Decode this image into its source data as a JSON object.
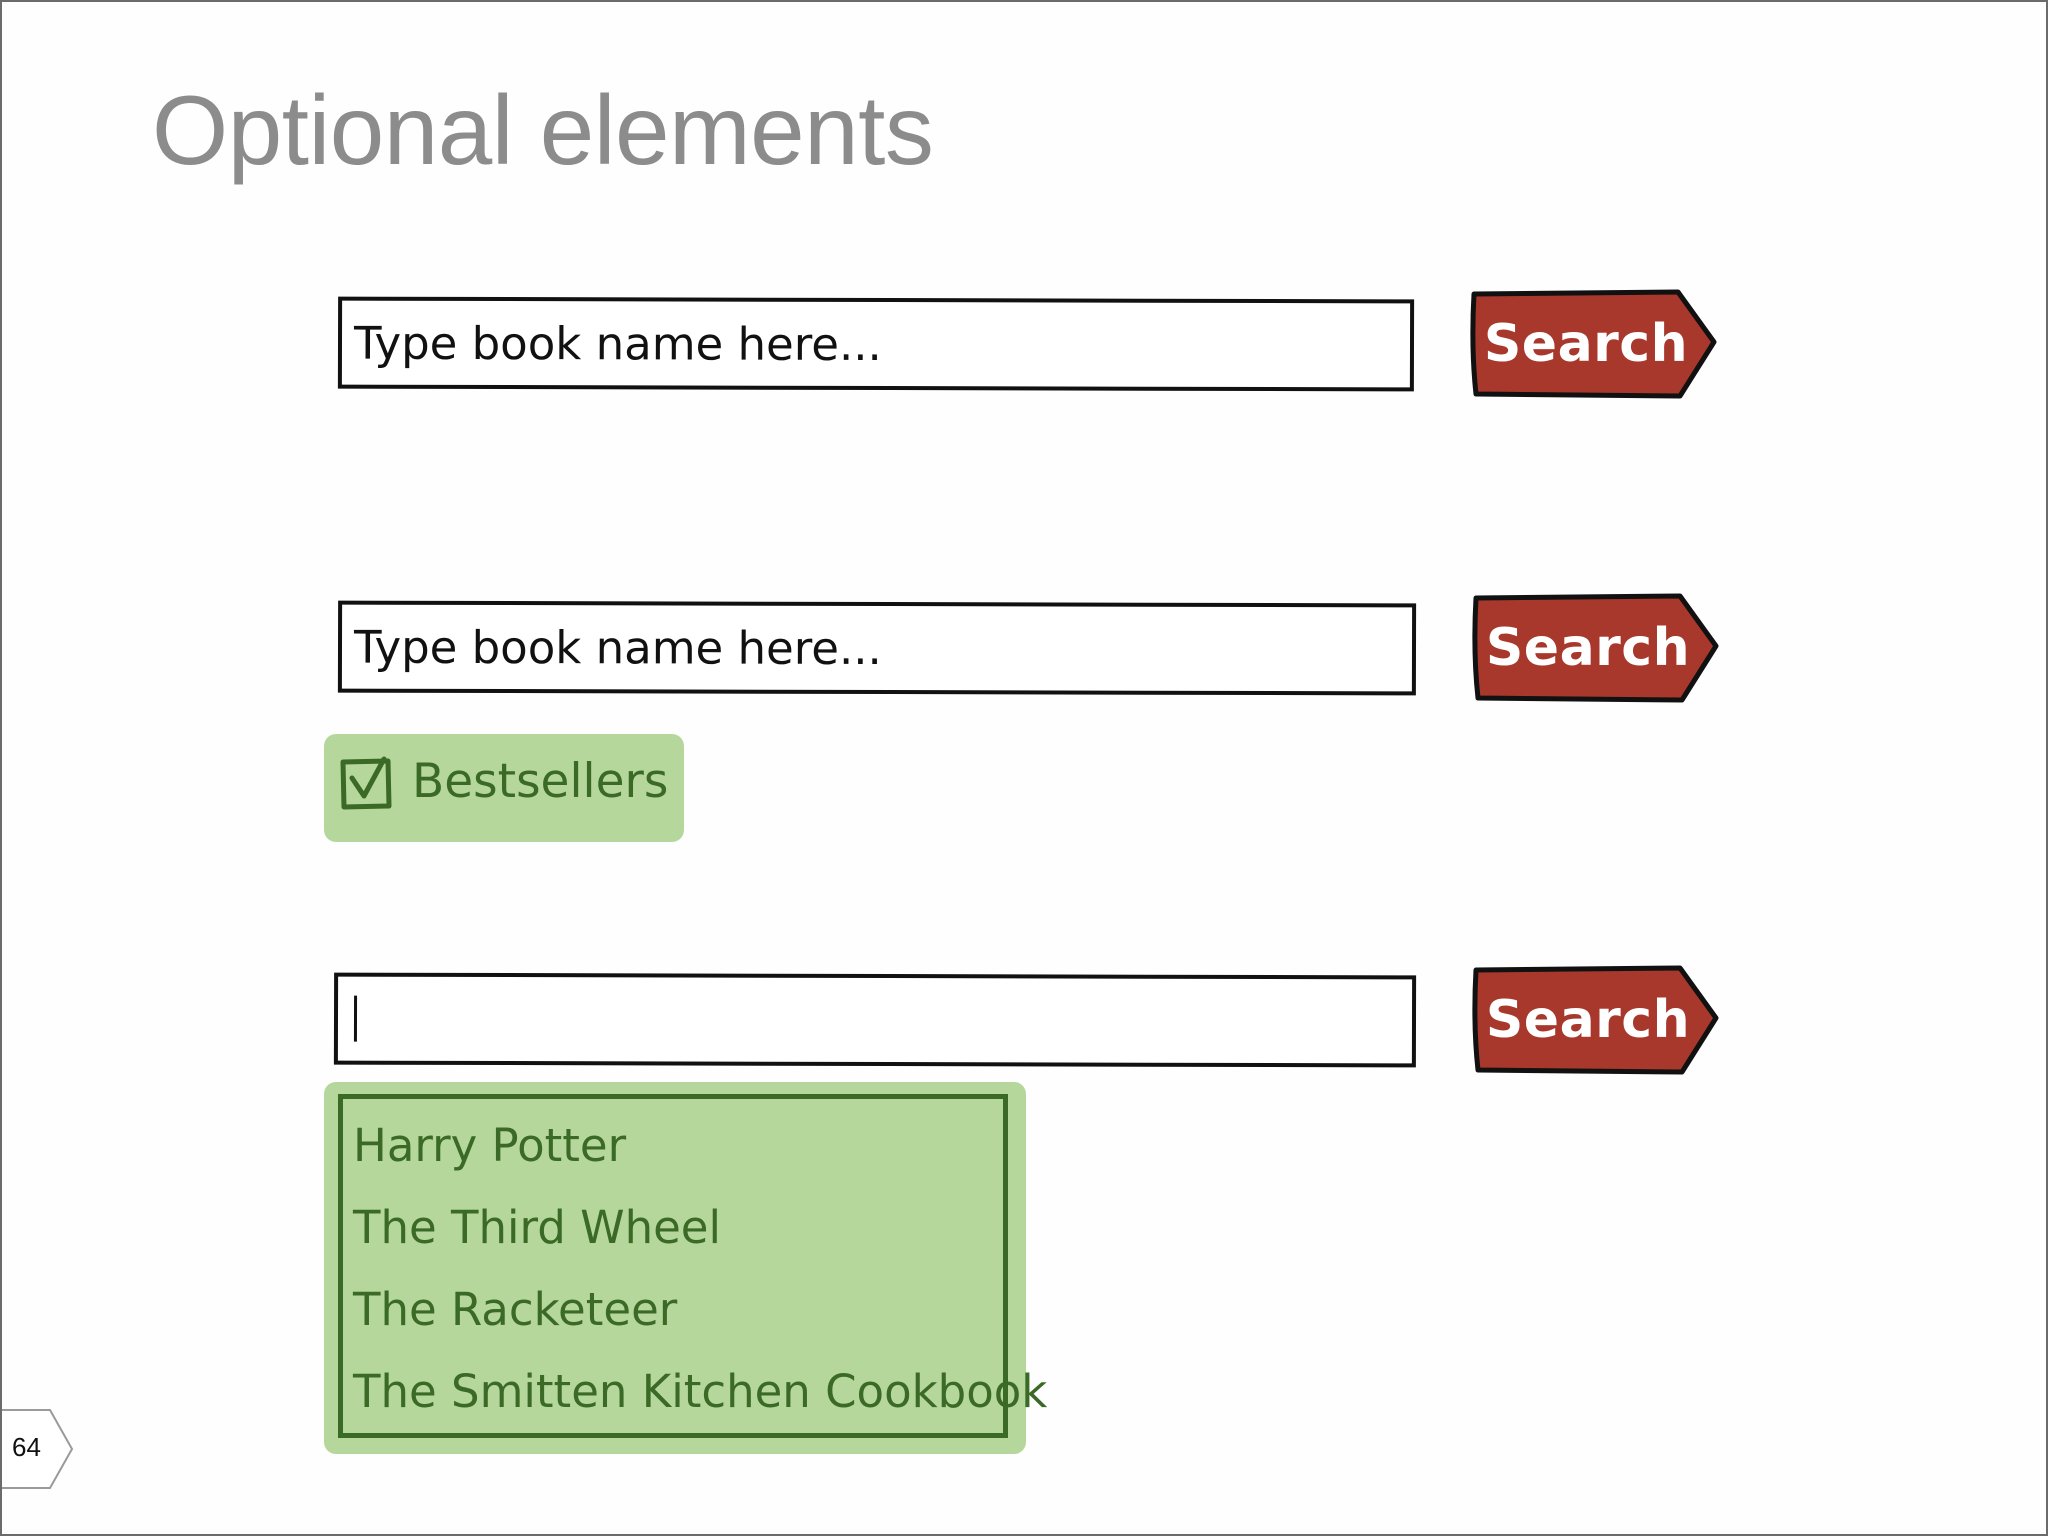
{
  "slide": {
    "title": "Optional elements",
    "page_number": "64"
  },
  "colors": {
    "title_gray": "#8c8c8c",
    "button_red": "#a8382c",
    "highlight_green": "#b5d79c",
    "highlight_text": "#3a6a25"
  },
  "example_basic": {
    "search_input_placeholder": "Type book name here...",
    "search_button_label": "Search"
  },
  "example_checkbox": {
    "search_input_placeholder": "Type book name here...",
    "search_button_label": "Search",
    "checkbox_label": "Bestsellers",
    "checkbox_checked": true
  },
  "example_autocomplete": {
    "search_input_value": "",
    "search_button_label": "Search",
    "suggestions": [
      "Harry Potter",
      "The Third Wheel",
      "The Racketeer",
      "The Smitten Kitchen Cookbook"
    ]
  },
  "icons": {
    "checkbox": "checkbox-checked-icon",
    "page_marker": "page-tab-icon"
  }
}
